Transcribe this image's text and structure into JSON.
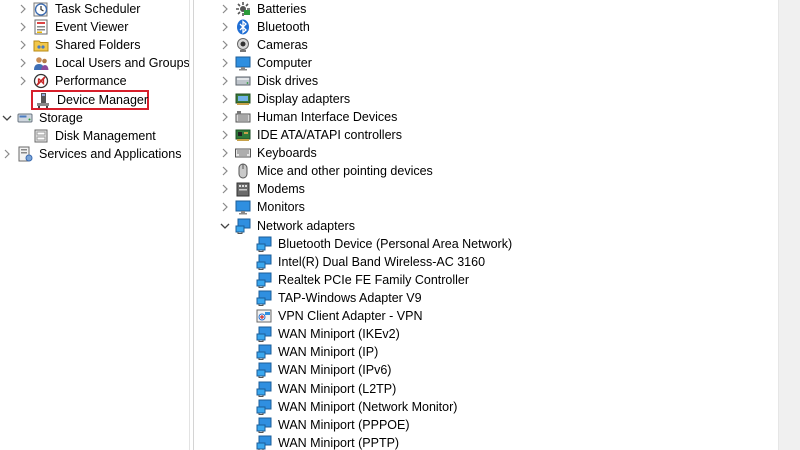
{
  "left_tree": {
    "items": [
      {
        "label": "Task Scheduler",
        "icon": "clock-calendar-icon",
        "expander": "collapsed"
      },
      {
        "label": "Event Viewer",
        "icon": "event-log-icon",
        "expander": "collapsed"
      },
      {
        "label": "Shared Folders",
        "icon": "shared-folder-icon",
        "expander": "collapsed"
      },
      {
        "label": "Local Users and Groups",
        "icon": "users-icon",
        "expander": "collapsed"
      },
      {
        "label": "Performance",
        "icon": "performance-icon",
        "expander": "collapsed"
      },
      {
        "label": "Device Manager",
        "icon": "device-manager-icon",
        "expander": "none",
        "highlighted": true
      },
      {
        "label": "Storage",
        "icon": "storage-icon",
        "expander": "expanded"
      },
      {
        "label": "Disk Management",
        "icon": "disk-management-icon",
        "expander": "none"
      },
      {
        "label": "Services and Applications",
        "icon": "services-icon",
        "expander": "collapsed"
      }
    ],
    "highlight_color": "#d71f2b"
  },
  "device_tree": {
    "categories": [
      {
        "label": "Batteries",
        "icon": "battery-icon",
        "expander": "collapsed"
      },
      {
        "label": "Bluetooth",
        "icon": "bluetooth-icon",
        "expander": "collapsed"
      },
      {
        "label": "Cameras",
        "icon": "camera-icon",
        "expander": "collapsed"
      },
      {
        "label": "Computer",
        "icon": "computer-icon",
        "expander": "collapsed"
      },
      {
        "label": "Disk drives",
        "icon": "disk-drive-icon",
        "expander": "collapsed"
      },
      {
        "label": "Display adapters",
        "icon": "display-adapter-icon",
        "expander": "collapsed"
      },
      {
        "label": "Human Interface Devices",
        "icon": "hid-icon",
        "expander": "collapsed"
      },
      {
        "label": "IDE ATA/ATAPI controllers",
        "icon": "ide-controller-icon",
        "expander": "collapsed"
      },
      {
        "label": "Keyboards",
        "icon": "keyboard-icon",
        "expander": "collapsed"
      },
      {
        "label": "Mice and other pointing devices",
        "icon": "mouse-icon",
        "expander": "collapsed"
      },
      {
        "label": "Modems",
        "icon": "modem-icon",
        "expander": "collapsed"
      },
      {
        "label": "Monitors",
        "icon": "monitor-icon",
        "expander": "collapsed"
      },
      {
        "label": "Network adapters",
        "icon": "network-adapter-icon",
        "expander": "expanded"
      }
    ],
    "network_adapters": [
      {
        "label": "Bluetooth Device (Personal Area Network)",
        "icon": "network-adapter-icon"
      },
      {
        "label": "Intel(R) Dual Band Wireless-AC 3160",
        "icon": "network-adapter-icon"
      },
      {
        "label": "Realtek PCIe FE Family Controller",
        "icon": "network-adapter-icon"
      },
      {
        "label": "TAP-Windows Adapter V9",
        "icon": "network-adapter-icon"
      },
      {
        "label": "VPN Client Adapter - VPN",
        "icon": "vpn-adapter-icon"
      },
      {
        "label": "WAN Miniport (IKEv2)",
        "icon": "network-adapter-icon"
      },
      {
        "label": "WAN Miniport (IP)",
        "icon": "network-adapter-icon"
      },
      {
        "label": "WAN Miniport (IPv6)",
        "icon": "network-adapter-icon"
      },
      {
        "label": "WAN Miniport (L2TP)",
        "icon": "network-adapter-icon"
      },
      {
        "label": "WAN Miniport (Network Monitor)",
        "icon": "network-adapter-icon"
      },
      {
        "label": "WAN Miniport (PPPOE)",
        "icon": "network-adapter-icon"
      },
      {
        "label": "WAN Miniport (PPTP)",
        "icon": "network-adapter-icon"
      }
    ]
  }
}
